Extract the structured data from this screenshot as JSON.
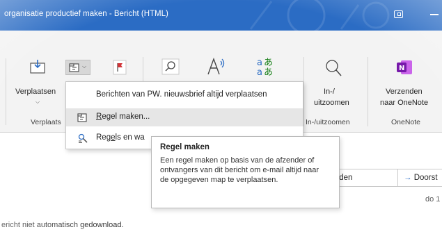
{
  "window": {
    "title": "organisatie productief maken  -  Bericht (HTML)"
  },
  "ribbon": {
    "move_group": {
      "move_button_label": "Verplaatsen",
      "group_label": "Verplaats"
    },
    "zoom_group": {
      "zoom_label_line1": "In-/",
      "zoom_label_line2": "uitzoomen",
      "group_label": "In-/uitzoomen"
    },
    "onenote_group": {
      "send_label_line1": "Verzenden",
      "send_label_line2": "naar OneNote",
      "group_label": "OneNote"
    }
  },
  "rules_menu": {
    "items": [
      {
        "label": "Berichten van PW. nieuwsbrief altijd verplaatsen",
        "icon": "none",
        "highlighted": false
      },
      {
        "label_prefix": "",
        "label_underlined": "R",
        "label_suffix": "egel maken...",
        "icon": "create-rule-icon",
        "highlighted": true
      },
      {
        "label_prefix": "Reg",
        "label_underlined": "e",
        "label_suffix": "ls en wa",
        "icon": "manage-rules-icon",
        "highlighted": false
      }
    ]
  },
  "tooltip": {
    "title": "Regel maken",
    "body": "Een regel maken op basis van de afzender of ontvangers van dit bericht om e-mail altijd naar de opgegeven map te verplaatsen."
  },
  "message": {
    "forward_partial": "orden",
    "forward_button_label": "Doorst",
    "date_partial": "do 1",
    "download_notice": "ericht niet automatisch gedownload."
  },
  "colors": {
    "title_bar": "#2b6cc4",
    "ribbon_bg": "#f3f3f3",
    "menu_highlight": "#e6e6e6",
    "onenote_purple": "#7719aa",
    "flag_red": "#d13438",
    "translate_blue": "#2b6cc4",
    "translate_green": "#107c10"
  }
}
